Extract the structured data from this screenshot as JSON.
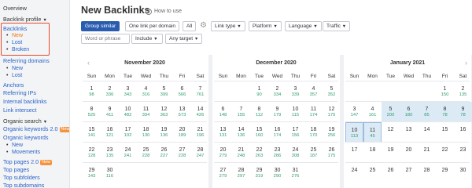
{
  "sidebar": {
    "overview": "Overview",
    "backlink_profile": "Backlink profile",
    "backlinks": "Backlinks",
    "backlinks_sub": [
      "New",
      "Lost",
      "Broken"
    ],
    "referring_domains": "Referring domains",
    "referring_domains_sub": [
      "New",
      "Lost"
    ],
    "anchors": "Anchors",
    "referring_ips": "Referring IPs",
    "internal_backlinks": "Internal backlinks",
    "link_intersect": "Link intersect",
    "organic_search": "Organic search",
    "organic_keywords_2": "Organic keywords 2.0",
    "new_badge": "New",
    "organic_keywords": "Organic keywords",
    "organic_keywords_sub": [
      "New",
      "Movements"
    ],
    "top_pages_2": "Top pages 2.0",
    "top_pages": "Top pages",
    "top_subfolders": "Top subfolders",
    "top_subdomains": "Top subdomains"
  },
  "header": {
    "title": "New Backlinks",
    "how_to": "How to use"
  },
  "toolbar": {
    "group_similar": "Group similar",
    "one_link_per_domain": "One link per domain",
    "all": "All",
    "link_type": "Link type",
    "platform": "Platform",
    "language": "Language",
    "traffic": "Traffic",
    "search_placeholder": "Word or phrase",
    "include": "Include",
    "any_target": "Any target"
  },
  "calendar": {
    "weekdays": [
      "Sun",
      "Mon",
      "Tue",
      "Wed",
      "Thu",
      "Fri",
      "Sat"
    ],
    "months": [
      {
        "title": "November 2020",
        "rows": [
          [
            {
              "d": "1",
              "c": "98"
            },
            {
              "d": "2",
              "c": "336"
            },
            {
              "d": "3",
              "c": "343"
            },
            {
              "d": "4",
              "c": "316"
            },
            {
              "d": "5",
              "c": "399"
            },
            {
              "d": "6",
              "c": "566"
            },
            {
              "d": "7",
              "c": "761"
            }
          ],
          [
            {
              "d": "8",
              "c": "525"
            },
            {
              "d": "9",
              "c": "411"
            },
            {
              "d": "10",
              "c": "482"
            },
            {
              "d": "11",
              "c": "394"
            },
            {
              "d": "12",
              "c": "363"
            },
            {
              "d": "13",
              "c": "573"
            },
            {
              "d": "14",
              "c": "426"
            }
          ],
          [
            {
              "d": "15",
              "c": "141"
            },
            {
              "d": "16",
              "c": "121"
            },
            {
              "d": "17",
              "c": "102"
            },
            {
              "d": "18",
              "c": "130"
            },
            {
              "d": "19",
              "c": "136"
            },
            {
              "d": "20",
              "c": "189"
            },
            {
              "d": "21",
              "c": "196"
            }
          ],
          [
            {
              "d": "22",
              "c": "128"
            },
            {
              "d": "23",
              "c": "135"
            },
            {
              "d": "24",
              "c": "241"
            },
            {
              "d": "25",
              "c": "228"
            },
            {
              "d": "26",
              "c": "227"
            },
            {
              "d": "27",
              "c": "228"
            },
            {
              "d": "28",
              "c": "247"
            }
          ],
          [
            {
              "d": "29",
              "c": "143"
            },
            {
              "d": "30",
              "c": "116"
            }
          ]
        ]
      },
      {
        "title": "December 2020",
        "rows": [
          [
            {
              "d": "",
              "c": ""
            },
            {
              "d": "",
              "c": ""
            },
            {
              "d": "1",
              "c": "90"
            },
            {
              "d": "2",
              "c": "334"
            },
            {
              "d": "3",
              "c": "339"
            },
            {
              "d": "4",
              "c": "357"
            },
            {
              "d": "5",
              "c": "352"
            }
          ],
          [
            {
              "d": "6",
              "c": "148"
            },
            {
              "d": "7",
              "c": "155"
            },
            {
              "d": "8",
              "c": "112"
            },
            {
              "d": "9",
              "c": "179"
            },
            {
              "d": "10",
              "c": "115"
            },
            {
              "d": "11",
              "c": "174"
            },
            {
              "d": "12",
              "c": "175"
            }
          ],
          [
            {
              "d": "13",
              "c": "131"
            },
            {
              "d": "14",
              "c": "136"
            },
            {
              "d": "15",
              "c": "160"
            },
            {
              "d": "16",
              "c": "174"
            },
            {
              "d": "17",
              "c": "156"
            },
            {
              "d": "18",
              "c": "170"
            },
            {
              "d": "19",
              "c": "256"
            }
          ],
          [
            {
              "d": "20",
              "c": "279"
            },
            {
              "d": "21",
              "c": "248"
            },
            {
              "d": "22",
              "c": "263"
            },
            {
              "d": "23",
              "c": "286"
            },
            {
              "d": "24",
              "c": "308"
            },
            {
              "d": "25",
              "c": "187"
            },
            {
              "d": "26",
              "c": "175"
            }
          ],
          [
            {
              "d": "27",
              "c": "279"
            },
            {
              "d": "28",
              "c": "297"
            },
            {
              "d": "29",
              "c": "319"
            },
            {
              "d": "30",
              "c": "290"
            },
            {
              "d": "31",
              "c": "276"
            }
          ]
        ]
      },
      {
        "title": "January 2021",
        "rows": [
          [
            {
              "d": "",
              "c": ""
            },
            {
              "d": "",
              "c": ""
            },
            {
              "d": "",
              "c": ""
            },
            {
              "d": "",
              "c": ""
            },
            {
              "d": "",
              "c": ""
            },
            {
              "d": "1",
              "c": "150"
            },
            {
              "d": "2",
              "c": "135"
            }
          ],
          [
            {
              "d": "3",
              "c": "147"
            },
            {
              "d": "4",
              "c": "161"
            },
            {
              "d": "5",
              "c": "200"
            },
            {
              "d": "6",
              "c": "180"
            },
            {
              "d": "7",
              "c": "85"
            },
            {
              "d": "8",
              "c": "78"
            },
            {
              "d": "9",
              "c": "78"
            }
          ],
          [
            {
              "d": "10",
              "c": "113"
            },
            {
              "d": "11",
              "c": "45"
            },
            {
              "d": "12",
              "c": ""
            },
            {
              "d": "13",
              "c": ""
            },
            {
              "d": "14",
              "c": ""
            },
            {
              "d": "15",
              "c": ""
            },
            {
              "d": "16",
              "c": ""
            }
          ],
          [
            {
              "d": "17",
              "c": ""
            },
            {
              "d": "18",
              "c": ""
            },
            {
              "d": "19",
              "c": ""
            },
            {
              "d": "20",
              "c": ""
            },
            {
              "d": "21",
              "c": ""
            },
            {
              "d": "22",
              "c": ""
            },
            {
              "d": "23",
              "c": ""
            }
          ],
          [
            {
              "d": "24",
              "c": ""
            },
            {
              "d": "25",
              "c": ""
            },
            {
              "d": "26",
              "c": ""
            },
            {
              "d": "27",
              "c": ""
            },
            {
              "d": "28",
              "c": ""
            },
            {
              "d": "29",
              "c": ""
            },
            {
              "d": "30",
              "c": ""
            }
          ]
        ]
      }
    ]
  },
  "colors": {
    "accent": "#2a5db0",
    "orange": "#f0761a",
    "count_green": "#2e9c6b",
    "selected_bg": "#dceaf6",
    "highlight_red": "#e8472a"
  }
}
